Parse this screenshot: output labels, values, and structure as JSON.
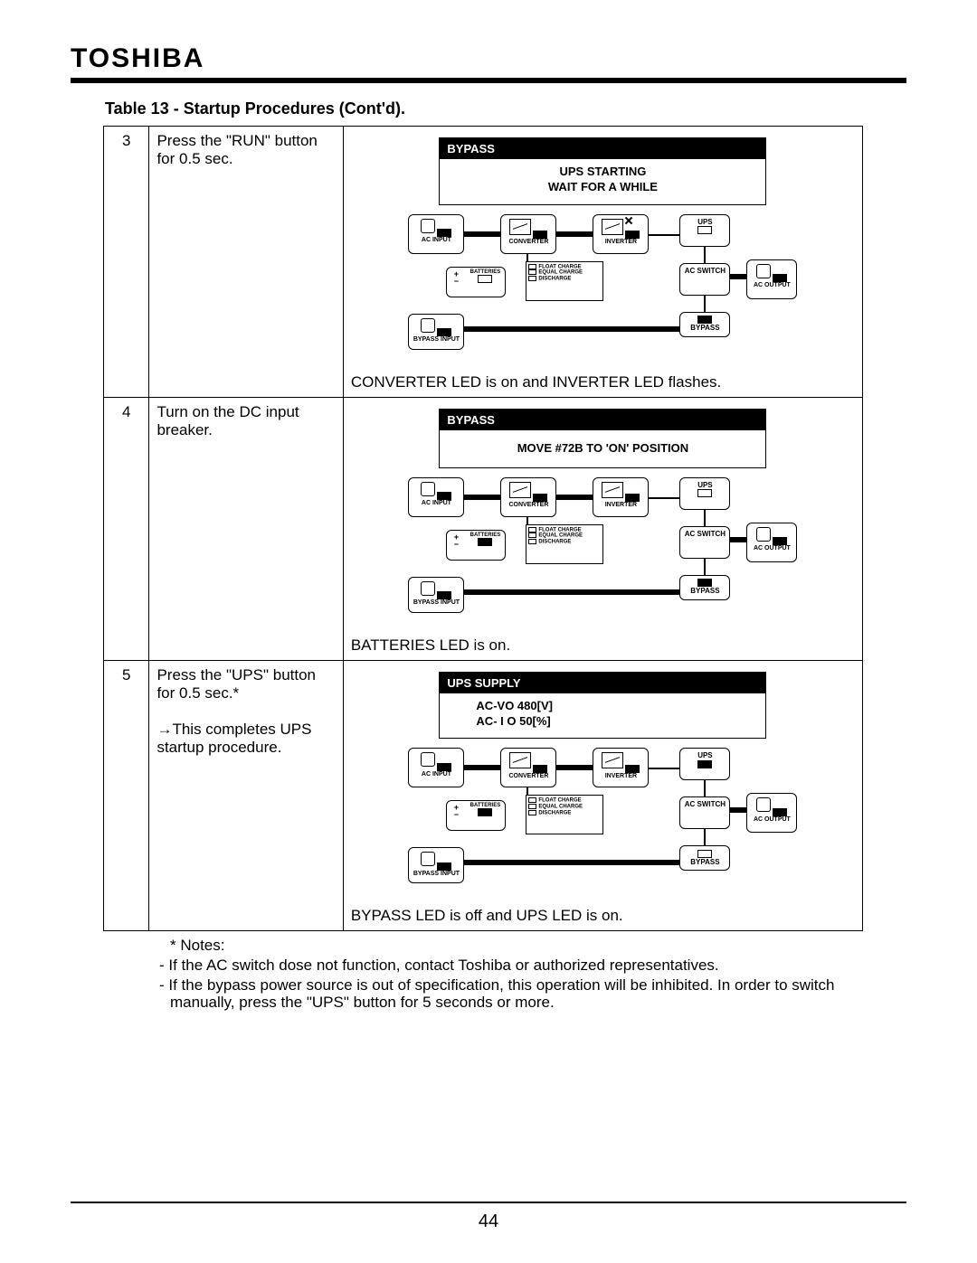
{
  "brand": "TOSHIBA",
  "page_number": "44",
  "table_title": "Table 13 - Startup Procedures (Cont'd).",
  "diagram_labels": {
    "ac_input": "AC INPUT",
    "converter": "CONVERTER",
    "inverter": "INVERTER",
    "ups": "UPS",
    "batteries": "BATTERIES",
    "float": "FLOAT CHARGE",
    "equal": "EQUAL CHARGE",
    "discharge": "DISCHARGE",
    "ac_switch": "AC\nSWITCH",
    "ac_output": "AC OUTPUT",
    "bypass_input": "BYPASS INPUT",
    "bypass": "BYPASS"
  },
  "rows": [
    {
      "n": "3",
      "instr": "Press the \"RUN\" button for 0.5 sec.",
      "lcd_header": "BYPASS",
      "lcd_line1": "UPS STARTING",
      "lcd_line2": "WAIT FOR A WHILE",
      "lcd_align": "center",
      "caption": "CONVERTER LED is on and INVERTER LED flashes.",
      "inverter_blink": true,
      "batteries_led_on": false,
      "ups_led_on": false,
      "bypass_led_on": true
    },
    {
      "n": "4",
      "instr": "Turn on the DC input breaker.",
      "lcd_header": "BYPASS",
      "lcd_line1": "MOVE #72B TO 'ON' POSITION",
      "lcd_line2": "",
      "lcd_align": "center",
      "caption": "BATTERIES LED is on.",
      "inverter_blink": false,
      "batteries_led_on": true,
      "ups_led_on": false,
      "bypass_led_on": true
    },
    {
      "n": "5",
      "instr": "Press the \"UPS\" button for 0.5 sec.*",
      "instr2": "→This completes UPS startup procedure.",
      "lcd_header": "UPS SUPPLY",
      "lcd_line1": "AC-VO   480[V]",
      "lcd_line2": "AC- I O    50[%]",
      "lcd_align": "left",
      "caption": "BYPASS LED is off and UPS LED is on.",
      "inverter_blink": false,
      "batteries_led_on": true,
      "ups_led_on": true,
      "bypass_led_on": false
    }
  ],
  "notes": {
    "heading": "* Notes:",
    "l1": "- If the AC switch dose not function, contact Toshiba or authorized representatives.",
    "l2": "- If the bypass power source is out of specification, this operation will be inhibited. In order to switch manually, press the \"UPS\" button for 5 seconds or more."
  }
}
